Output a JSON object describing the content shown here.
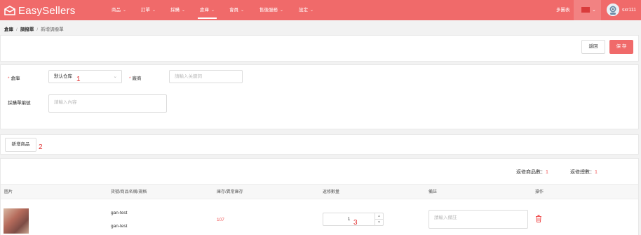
{
  "brand": {
    "name": "EasySellers",
    "accent": "#f06a6a"
  },
  "nav": {
    "items": [
      {
        "label": "商品",
        "active": false
      },
      {
        "label": "訂單",
        "active": false
      },
      {
        "label": "採購",
        "active": false
      },
      {
        "label": "倉庫",
        "active": true
      },
      {
        "label": "會員",
        "active": false
      },
      {
        "label": "售後服務",
        "active": false
      },
      {
        "label": "設定",
        "active": false
      }
    ],
    "chevron": "⌄",
    "multi_store": "多圖表",
    "username": "sxr111"
  },
  "breadcrumb": [
    "倉庫",
    "調撥單",
    "新增調撥單"
  ],
  "actions": {
    "back_label": "返回",
    "save_label": "保 存"
  },
  "form": {
    "warehouse_label": "倉庫",
    "warehouse_value": "默认仓库",
    "supplier_label": "廠商",
    "supplier_placeholder": "請輸入关鍵詞",
    "order_no_label": "採購單編號",
    "order_no_placeholder": "請輸入內容"
  },
  "add_product_label": "新增商品",
  "annotations": [
    "1",
    "2",
    "3"
  ],
  "summary": {
    "items_label": "返修商品數：",
    "items_value": "1",
    "total_label": "返修總數：",
    "total_value": "1"
  },
  "table": {
    "headers": [
      "圖片",
      "貨號/商品名稱/規格",
      "庫存/異常庫存",
      "返修數量",
      "備註",
      "操作"
    ],
    "rows": [
      {
        "sku": "gan-test",
        "name": "gan-test",
        "stock": "107",
        "quantity": "1",
        "remark_placeholder": "請輸入備註"
      }
    ]
  }
}
